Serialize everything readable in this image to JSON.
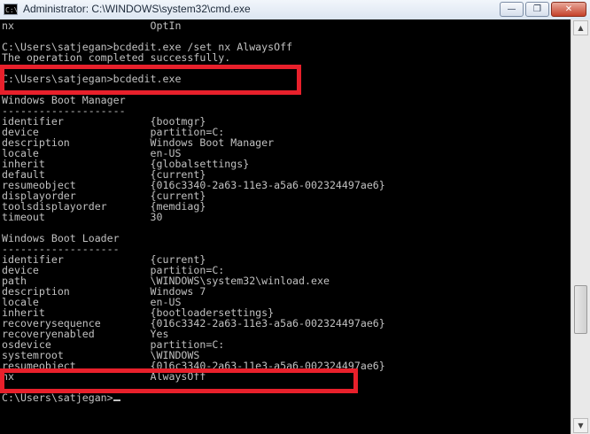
{
  "window": {
    "title": "Administrator: C:\\WINDOWS\\system32\\cmd.exe",
    "app_icon_text": "C:\\",
    "minimize_glyph": "—",
    "maximize_glyph": "❐",
    "close_glyph": "✕"
  },
  "console": {
    "lines": [
      "nx                      OptIn",
      "",
      "C:\\Users\\satjegan>bcdedit.exe /set nx AlwaysOff",
      "The operation completed successfully.",
      "",
      "C:\\Users\\satjegan>bcdedit.exe",
      "",
      "Windows Boot Manager",
      "--------------------",
      "identifier              {bootmgr}",
      "device                  partition=C:",
      "description             Windows Boot Manager",
      "locale                  en-US",
      "inherit                 {globalsettings}",
      "default                 {current}",
      "resumeobject            {016c3340-2a63-11e3-a5a6-002324497ae6}",
      "displayorder            {current}",
      "toolsdisplayorder       {memdiag}",
      "timeout                 30",
      "",
      "Windows Boot Loader",
      "-------------------",
      "identifier              {current}",
      "device                  partition=C:",
      "path                    \\WINDOWS\\system32\\winload.exe",
      "description             Windows 7",
      "locale                  en-US",
      "inherit                 {bootloadersettings}",
      "recoverysequence        {016c3342-2a63-11e3-a5a6-002324497ae6}",
      "recoveryenabled         Yes",
      "osdevice                partition=C:",
      "systemroot              \\WINDOWS",
      "resumeobject            {016c3340-2a63-11e3-a5a6-002324497ae6}",
      "nx                      AlwaysOff",
      "",
      "C:\\Users\\satjegan>"
    ]
  },
  "colors": {
    "console_bg": "#000000",
    "console_fg": "#c0c0c0",
    "highlight": "#e8202b"
  }
}
